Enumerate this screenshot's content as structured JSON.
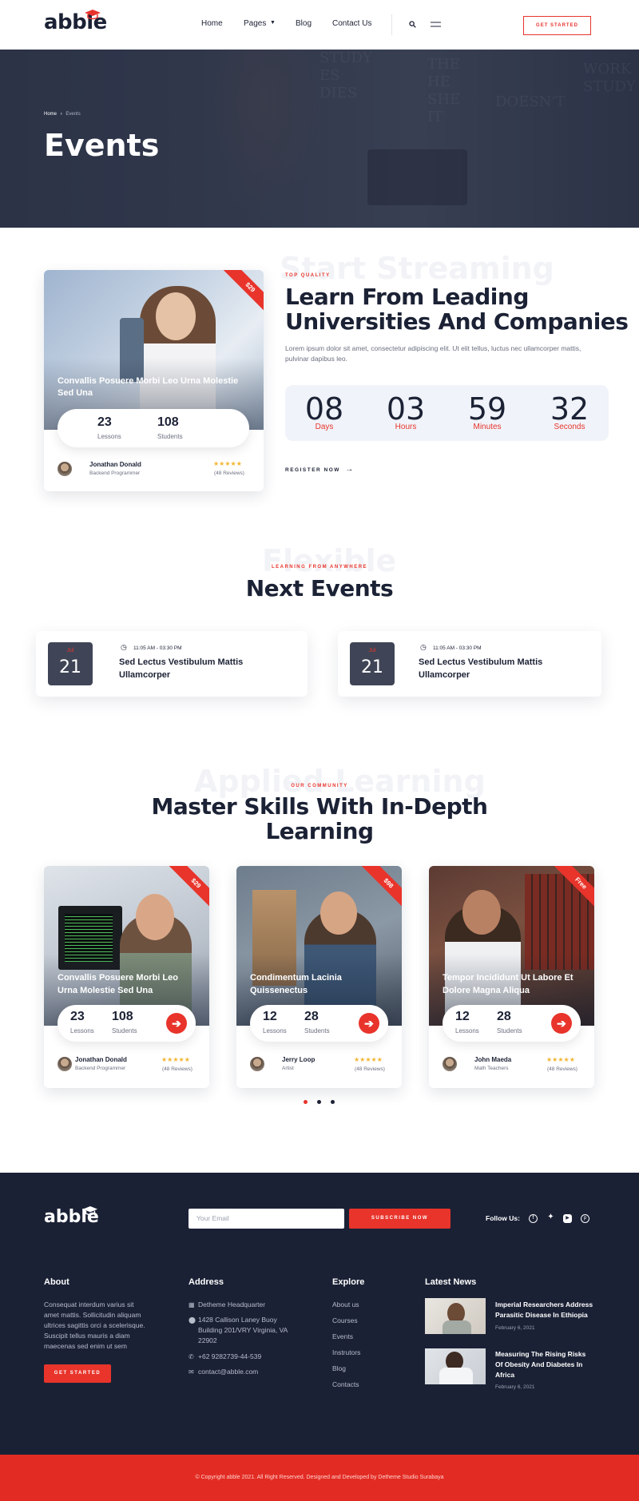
{
  "header": {
    "logo": "abble",
    "nav": [
      "Home",
      "Pages",
      "Blog",
      "Contact Us"
    ],
    "cta": "GET STARTED"
  },
  "hero": {
    "breadcrumb_home": "Home",
    "breadcrumb_current": "Events",
    "title": "Events"
  },
  "featured": {
    "card": {
      "price": "$29",
      "title": "Convallis Posuere Morbi Leo Urna Molestie Sed Una",
      "lessons": "23",
      "lessons_label": "Lessons",
      "students": "108",
      "students_label": "Students",
      "author": "Jonathan Donald",
      "role": "Backend Programmer",
      "stars": "★★★★★",
      "reviews": "(48 Reviews)"
    },
    "ghost": "Start Streaming",
    "eyebrow": "TOP QUALITY",
    "title_line1": "Learn From Leading",
    "title_line2": "Universities And Companies",
    "text": "Lorem ipsum dolor sit amet, consectetur adipiscing elit. Ut elit tellus, luctus nec ullamcorper mattis, pulvinar dapibus leo.",
    "countdown": [
      {
        "value": "08",
        "label": "Days"
      },
      {
        "value": "03",
        "label": "Hours"
      },
      {
        "value": "59",
        "label": "Minutes"
      },
      {
        "value": "32",
        "label": "Seconds"
      }
    ],
    "register": "REGISTER NOW"
  },
  "events": {
    "ghost": "Flexible",
    "eyebrow": "LEARNING FROM ANYWHERE",
    "title": "Next Events",
    "items": [
      {
        "month": "Jul",
        "day": "21",
        "time": "11:05 AM - 03:30 PM",
        "title_line1": "Sed Lectus Vestibulum Mattis",
        "title_line2": "Ullamcorper"
      },
      {
        "month": "Jul",
        "day": "21",
        "time": "11:05 AM - 03:30 PM",
        "title_line1": "Sed Lectus Vestibulum Mattis",
        "title_line2": "Ullamcorper"
      }
    ]
  },
  "courses": {
    "ghost": "Applied Learning",
    "eyebrow": "OUR COMMUNITY",
    "title_line1": "Master Skills With In-Depth",
    "title_line2": "Learning",
    "items": [
      {
        "price": "$29",
        "title_line1": "Convallis Posuere Morbi Leo",
        "title_line2": "Urna Molestie Sed Una",
        "lessons": "23",
        "students": "108",
        "author": "Jonathan Donald",
        "role": "Backend Programmer",
        "stars": "★★★★★",
        "reviews": "(48 Reviews)"
      },
      {
        "price": "$98",
        "title_line1": "Condimentum Lacinia",
        "title_line2": "Quissenectus",
        "lessons": "12",
        "students": "28",
        "author": "Jerry Loop",
        "role": "Artist",
        "stars": "★★★★★",
        "reviews": "(48 Reviews)"
      },
      {
        "price": "Free",
        "title_line1": "Tempor Incididunt Ut Labore Et",
        "title_line2": "Dolore Magna Aliqua",
        "lessons": "12",
        "students": "28",
        "author": "John Maeda",
        "role": "Math Teachers",
        "stars": "★★★★★",
        "reviews": "(48 Reviews)"
      }
    ],
    "lessons_label": "Lessons",
    "students_label": "Students"
  },
  "footer": {
    "logo": "abble",
    "email_placeholder": "Your Email",
    "subscribe": "SUBSCRIBE NOW",
    "follow": "Follow Us:",
    "about_title": "About",
    "about_text": [
      "Consequat interdum varius sit",
      "amet mattis. Sollicitudin aliquam",
      "ultrices sagittis orci a scelerisque.",
      "Suscipit tellus mauris a diam",
      "maecenas sed enim ut sem"
    ],
    "about_button": "GET STARTED",
    "address_title": "Address",
    "address_hq": "Detheme Headquarter",
    "address_line1": "1428 Callison Laney Buoy",
    "address_line2": "Building 201/VRY Virginia, VA",
    "address_line3": "22902",
    "phone": "+62 9282739-44-539",
    "email": "contact@abble.com",
    "explore_title": "Explore",
    "explore": [
      "About us",
      "Courses",
      "Events",
      "Instrutors",
      "Blog",
      "Contacts"
    ],
    "news_title": "Latest News",
    "news": [
      {
        "title_line1": "Imperial Researchers Address",
        "title_line2": "Parasitic Disease In Ethiopia",
        "title_line3": "",
        "date": "February 6, 2021"
      },
      {
        "title_line1": "Measuring The Rising Risks",
        "title_line2": "Of Obesity And Diabetes In",
        "title_line3": "Africa",
        "date": "February 6, 2021"
      }
    ],
    "copyright": "© Copyright abble 2021. All Right Reserved. Designed and Developed by Detheme Studio Surabaya"
  },
  "colors": {
    "accent": "#e8342b",
    "navy": "#1b2135",
    "countdown_bg": "#f0f3f9"
  }
}
